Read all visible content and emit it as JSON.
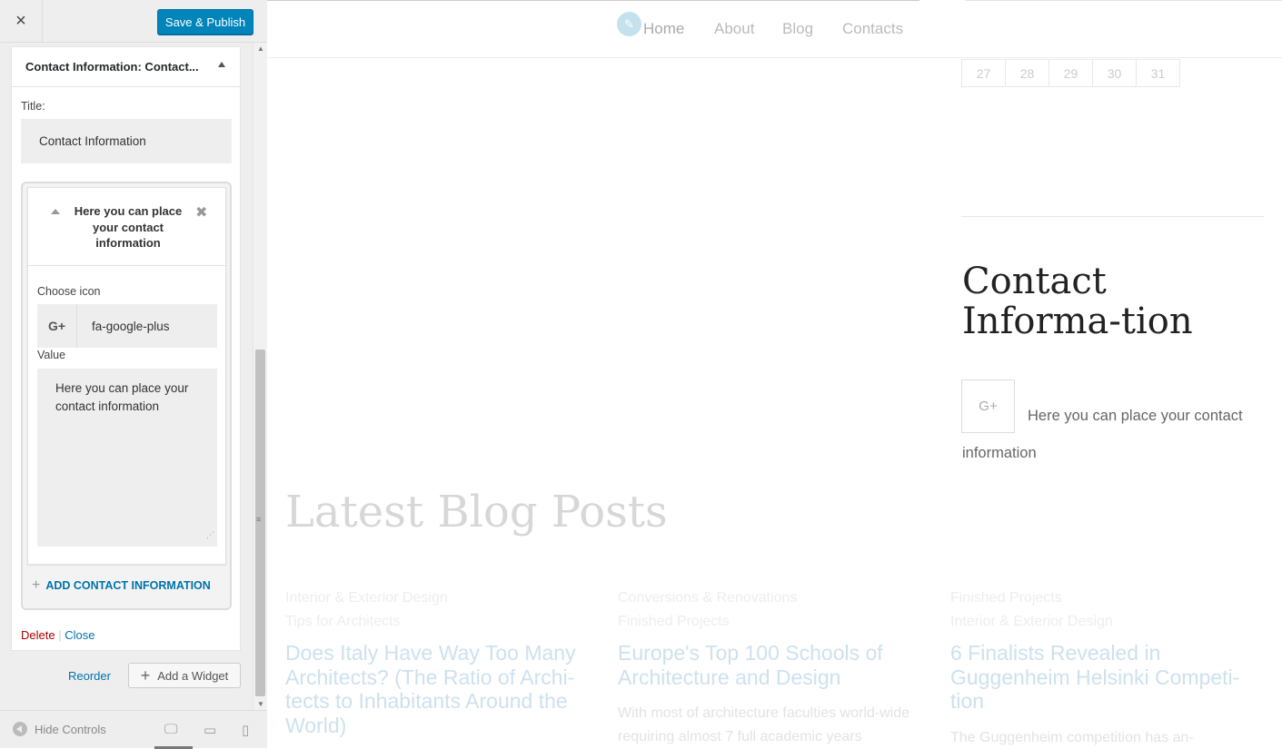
{
  "sidebar": {
    "close_label": "×",
    "save_label": "Save & Publish",
    "widget_title": "Contact Information: Contact...",
    "title_label": "Title:",
    "title_value": "Contact Information",
    "item": {
      "title": "Here you can place your contact information",
      "choose_icon_label": "Choose icon",
      "icon_glyph": "G+",
      "icon_value": "fa-google-plus",
      "value_label": "Value",
      "value_text": "Here you can place your contact information"
    },
    "add_contact_label": "ADD CONTACT INFORMATION",
    "delete_label": "Delete",
    "separator": "|",
    "close_link_label": "Close",
    "reorder_label": "Reorder",
    "add_widget_label": "Add a Widget",
    "hide_controls_label": "Hide Controls"
  },
  "preview": {
    "nav": [
      "Home",
      "About",
      "Blog",
      "Contacts"
    ],
    "calendar_days": [
      "27",
      "28",
      "29",
      "30",
      "31"
    ],
    "contact_heading": "Contact Informa-tion",
    "contact_icon": "G+",
    "contact_text": "Here you can place your contact information",
    "latest_heading": "Latest Blog Posts",
    "posts": [
      {
        "cat1": "Interior & Exterior Design",
        "cat2": "Tips for Architects",
        "title": "Does Italy Have Way Too Many Architects? (The Ratio of Archi-tects to Inhabitants Around the World)",
        "excerpt": ""
      },
      {
        "cat1": "Conversions & Renovations",
        "cat2": "Finished Projects",
        "title": "Europe's Top 100 Schools of Architecture and Design",
        "excerpt": "With most of architecture faculties world-wide requiring almost 7 full academic years"
      },
      {
        "cat1": "Finished Projects",
        "cat2": "Interior & Exterior Design",
        "title": "6 Finalists Revealed in Guggenheim Helsinki Competi-tion",
        "excerpt": "The Guggenheim competition has an-"
      }
    ]
  },
  "colors": {
    "accent": "#0085ba",
    "link": "#0073aa",
    "delete": "#aa0000"
  }
}
